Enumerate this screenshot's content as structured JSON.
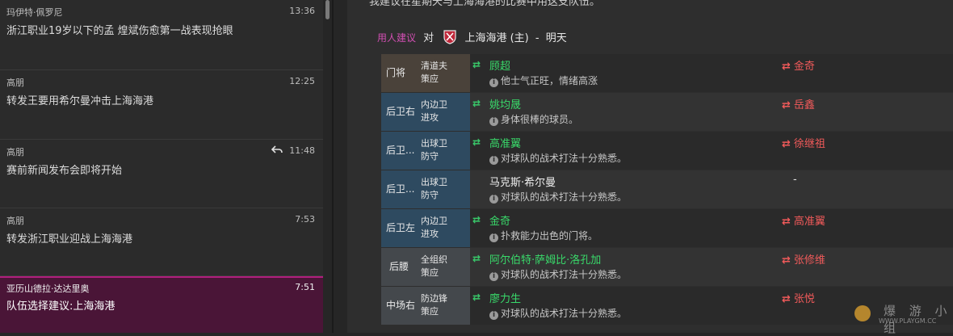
{
  "inbox": {
    "messages": [
      {
        "sender": "玛伊特·佩罗尼",
        "time": "13:36",
        "subject": "浙江职业19岁以下的孟 煌斌伤愈第一战表现抢眼",
        "replied": false,
        "selected": false
      },
      {
        "sender": "高朋",
        "time": "12:25",
        "subject": "转发王要用希尔曼冲击上海海港",
        "replied": false,
        "selected": false
      },
      {
        "sender": "高朋",
        "time": "11:48",
        "subject": "赛前新闻发布会即将开始",
        "replied": true,
        "selected": false
      },
      {
        "sender": "高朋",
        "time": "7:53",
        "subject": "转发浙江职业迎战上海海港",
        "replied": false,
        "selected": false
      },
      {
        "sender": "亚历山德拉·达达里奥",
        "time": "7:51",
        "subject": "队伍选择建议:上海海港",
        "replied": false,
        "selected": true
      }
    ]
  },
  "detail": {
    "top_text": "我建议在星期天与上海海港的比赛中用这支队伍。",
    "suggestion": {
      "label": "用人建议",
      "vs": "对",
      "opponent": "上海海港 (主)",
      "dot": "-",
      "day": "明天"
    },
    "rows": [
      {
        "position": "门将",
        "role": "清道夫",
        "duty": "策应",
        "player": "顾超",
        "note": "他士气正旺，情绪高涨",
        "swapped": true,
        "replaced": "金奇"
      },
      {
        "position": "后卫右",
        "role": "内边卫",
        "duty": "进攻",
        "player": "姚均晟",
        "note": "身体很棒的球员。",
        "swapped": true,
        "replaced": "岳鑫"
      },
      {
        "position": "后卫...",
        "role": "出球卫",
        "duty": "防守",
        "player": "高准翼",
        "note": "对球队的战术打法十分熟悉。",
        "swapped": true,
        "replaced": "徐继祖"
      },
      {
        "position": "后卫...",
        "role": "出球卫",
        "duty": "防守",
        "player": "马克斯·希尔曼",
        "note": "对球队的战术打法十分熟悉。",
        "swapped": false,
        "replaced": "-"
      },
      {
        "position": "后卫左",
        "role": "内边卫",
        "duty": "进攻",
        "player": "金奇",
        "note": "扑救能力出色的门将。",
        "swapped": true,
        "replaced": "高准翼"
      },
      {
        "position": "后腰",
        "role": "全组织",
        "duty": "策应",
        "player": "阿尔伯特·萨姆比·洛孔加",
        "note": "对球队的战术打法十分熟悉。",
        "swapped": true,
        "replaced": "张修维"
      },
      {
        "position": "中场右",
        "role": "防边锋",
        "duty": "策应",
        "player": "廖力生",
        "note": "对球队的战术打法十分熟悉。",
        "swapped": true,
        "replaced": "张悦"
      }
    ]
  },
  "watermark": {
    "title": "爆 游 小 组",
    "url": "WWW.PLAYGM.CC"
  },
  "colors": {
    "accent": "#b01e7d",
    "selected_bg": "#4a1537",
    "in_player": "#39d96a",
    "out_player": "#f05a5a",
    "gk_cell": "#4a423a",
    "def_cell": "#2e4a60",
    "mid_cell": "#44484c"
  }
}
